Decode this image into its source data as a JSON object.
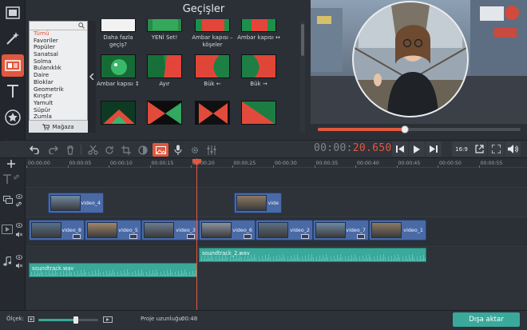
{
  "colors": {
    "accent": "#e0583f",
    "teal": "#3aa89a",
    "clip_blue": "#4a6aa6"
  },
  "gallery": {
    "title": "Geçişler",
    "categories": [
      "Tümü",
      "Favoriler",
      "Popüler",
      "Sanatsal",
      "Solma",
      "Bulanıklık",
      "Daire",
      "Bloklar",
      "Geometrik",
      "Kırıştır",
      "Yamult",
      "Süpür",
      "Zumla"
    ],
    "selected_category": "Tümü",
    "store_label": "Mağaza",
    "tiles": [
      {
        "label": "Daha fazla geçiş?"
      },
      {
        "label": "YENİ Set!"
      },
      {
        "label": "Ambar kapısı – köşeler"
      },
      {
        "label": "Ambar kapısı ↔"
      },
      {
        "label": "Ambar kapısı ↕"
      },
      {
        "label": "Ayır"
      },
      {
        "label": "Bük ←"
      },
      {
        "label": "Bük →"
      },
      {
        "label": ""
      },
      {
        "label": ""
      },
      {
        "label": ""
      },
      {
        "label": ""
      }
    ]
  },
  "playback": {
    "timecode_dim": "00:00:",
    "timecode_hot": "20.650",
    "aspect": "16:9",
    "scrub_fraction": 0.43
  },
  "ruler": [
    "00:00:00",
    "00:00:05",
    "00:00:10",
    "00:00:15",
    "00:00:20",
    "00:00:25",
    "00:00:30",
    "00:00:35",
    "00:00:40",
    "00:00:45",
    "00:00:50",
    "00:00:55"
  ],
  "tracks": {
    "overlay": [
      {
        "label": "video_4"
      },
      {
        "label": "vide"
      }
    ],
    "main": [
      {
        "label": "video_8"
      },
      {
        "label": "video_5"
      },
      {
        "label": "video_3"
      },
      {
        "label": "video_6"
      },
      {
        "label": "video_2"
      },
      {
        "label": "video_7"
      },
      {
        "label": "video_1"
      }
    ],
    "audio_upper": {
      "label": "soundtrack_2.wav"
    },
    "audio_lower": {
      "label": "soundtrack.wav"
    }
  },
  "bottom": {
    "zoom_label": "Ölçek:",
    "zoom_fraction": 0.62,
    "duration_label": "Proje uzunluğu:",
    "duration_value": "00:48",
    "export_label": "Dışa aktar"
  }
}
